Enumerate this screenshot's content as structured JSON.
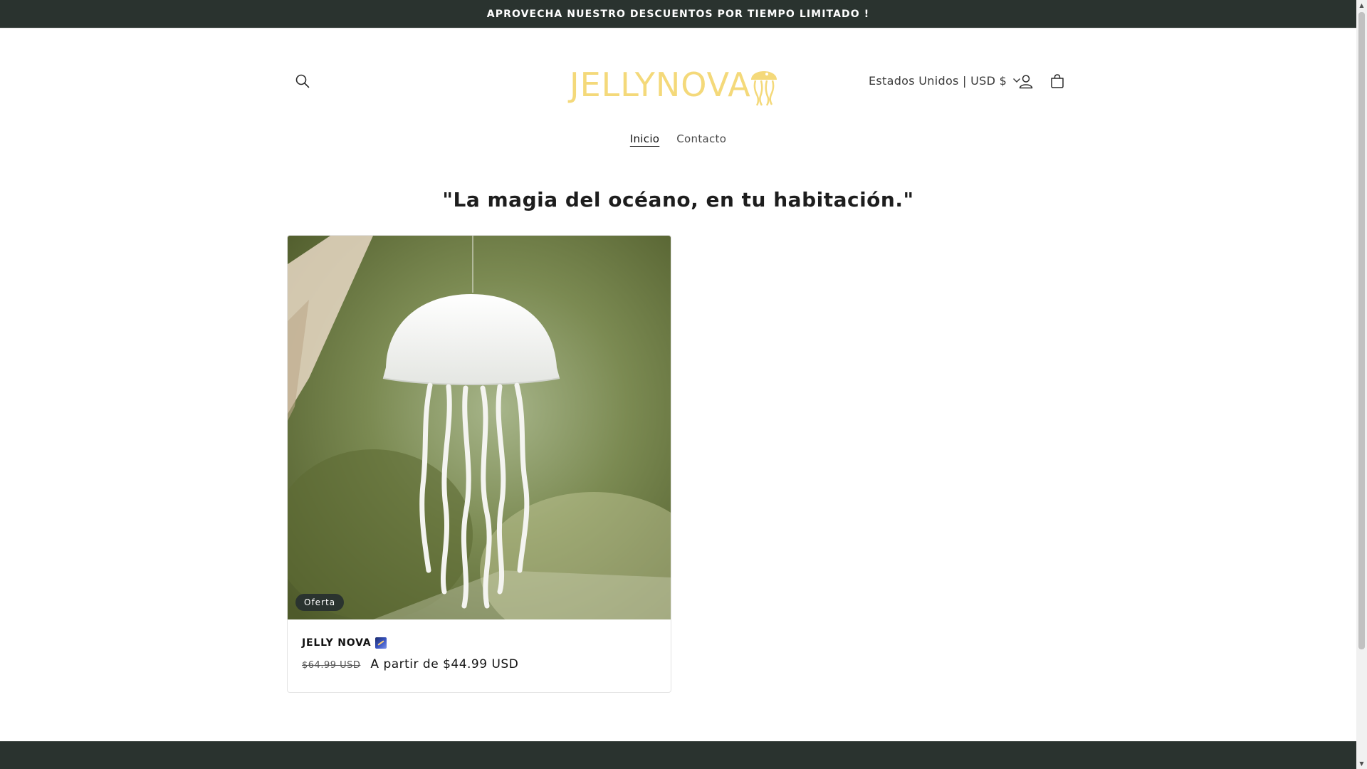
{
  "announcement": {
    "text": "APROVECHA NUESTRO DESCUENTOS POR TIEMPO LIMITADO !"
  },
  "header": {
    "logo_text": "JELLYNOVA",
    "country_selector": "Estados Unidos | USD $",
    "icons": {
      "search": "search-icon",
      "account": "account-icon",
      "cart": "cart-icon"
    },
    "logo_color": "#f4d97a"
  },
  "nav": {
    "items": [
      {
        "label": "Inicio",
        "active": true
      },
      {
        "label": "Contacto",
        "active": false
      }
    ]
  },
  "main": {
    "tagline": "\"La magia del océano, en tu habitación.\""
  },
  "product": {
    "badge": "Oferta",
    "title": "JELLY NOVA",
    "price_old": "$64.99 USD",
    "price_new": "A partir de $44.99 USD"
  },
  "colors": {
    "dark_bar": "#2a332f",
    "text": "#121212"
  }
}
